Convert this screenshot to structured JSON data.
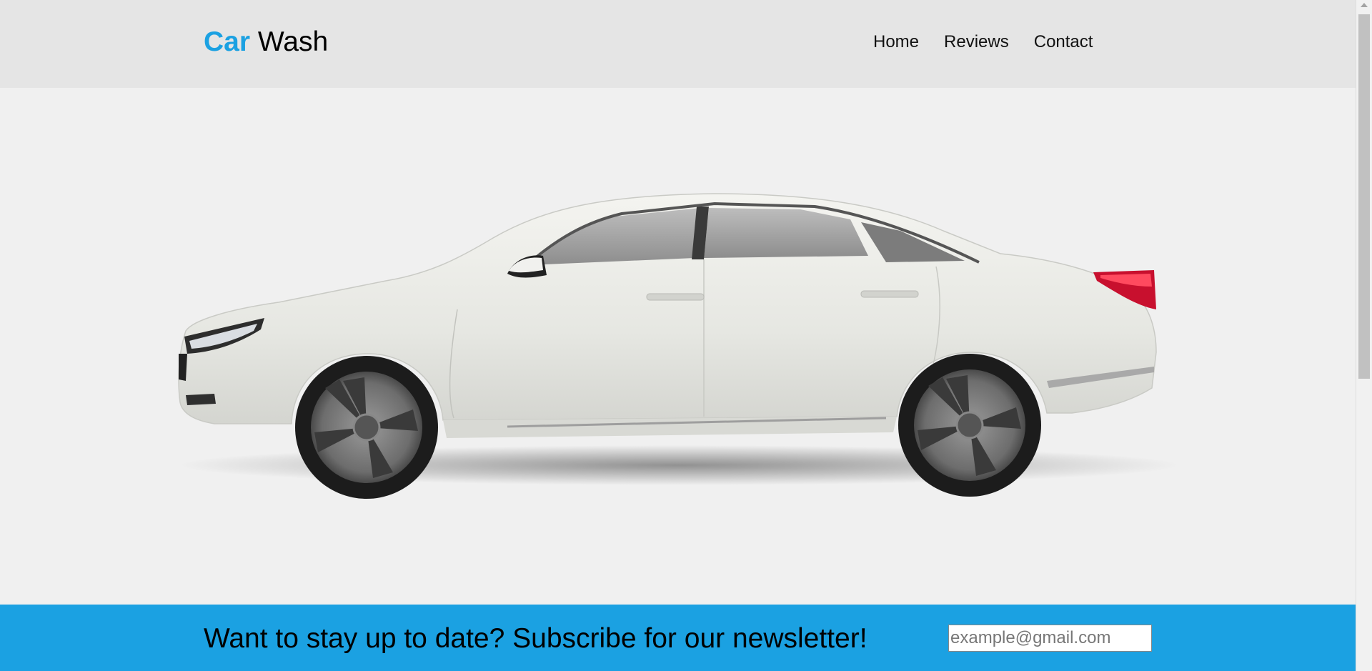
{
  "header": {
    "logo_accent": "Car",
    "logo_rest": "Wash",
    "nav": [
      "Home",
      "Reviews",
      "Contact"
    ]
  },
  "hero": {
    "image": "white-sedan-side-view"
  },
  "newsletter": {
    "text": "Want to stay up to date? Subscribe for our newsletter!",
    "placeholder": "example@gmail.com"
  },
  "colors": {
    "accent": "#1ba1e2",
    "header_bg": "#e5e5e5",
    "page_bg": "#f0f0f0"
  }
}
